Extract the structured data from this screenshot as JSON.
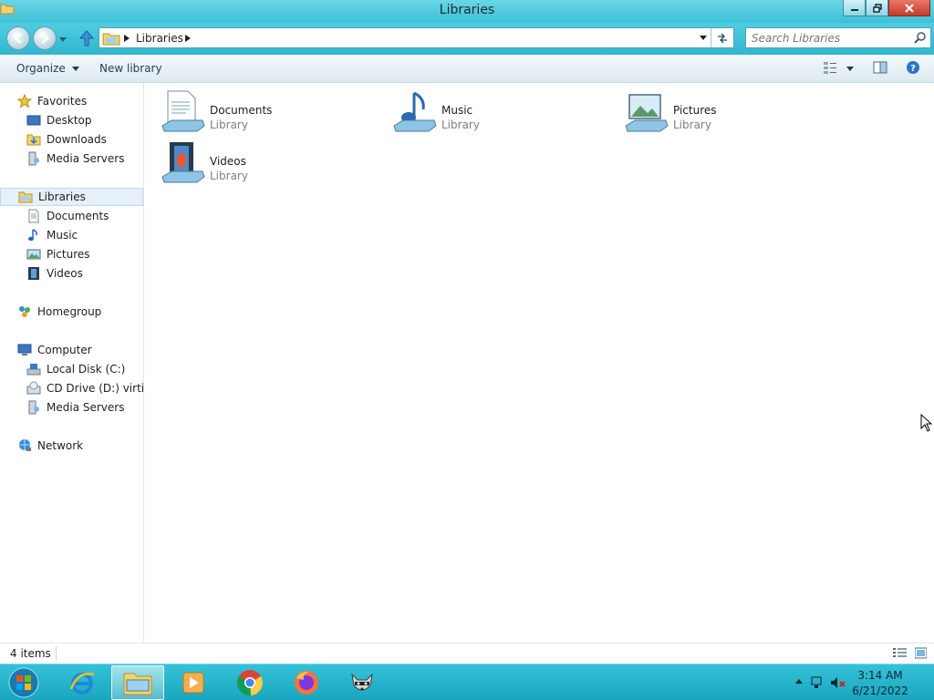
{
  "window": {
    "title": "Libraries"
  },
  "address_bar": {
    "breadcrumb": "Libraries"
  },
  "search": {
    "placeholder": "Search Libraries"
  },
  "toolbar": {
    "organize_label": "Organize",
    "new_library_label": "New library"
  },
  "nav_pane": {
    "favorites": {
      "label": "Favorites",
      "items": [
        "Desktop",
        "Downloads",
        "Media Servers"
      ]
    },
    "libraries": {
      "label": "Libraries",
      "items": [
        "Documents",
        "Music",
        "Pictures",
        "Videos"
      ]
    },
    "homegroup": {
      "label": "Homegroup"
    },
    "computer": {
      "label": "Computer",
      "items": [
        "Local Disk (C:)",
        "CD Drive (D:) virtio-win",
        "Media Servers"
      ]
    },
    "network": {
      "label": "Network"
    }
  },
  "content": {
    "items": [
      {
        "name": "Documents",
        "type": "Library",
        "icon": "documents-library-icon"
      },
      {
        "name": "Music",
        "type": "Library",
        "icon": "music-library-icon"
      },
      {
        "name": "Pictures",
        "type": "Library",
        "icon": "pictures-library-icon"
      },
      {
        "name": "Videos",
        "type": "Library",
        "icon": "videos-library-icon"
      }
    ]
  },
  "status_bar": {
    "item_count": "4 items"
  },
  "taskbar": {
    "apps": [
      "start-orb",
      "internet-explorer",
      "file-explorer",
      "media-player",
      "chrome",
      "firefox",
      "raccoon-app"
    ],
    "active_app": "file-explorer",
    "clock_time": "3:14 AM",
    "clock_date": "6/21/2022"
  },
  "colors": {
    "title_bar": "#3cc0d6",
    "taskbar": "#1aa6be",
    "selection": "#e5f0f9"
  }
}
